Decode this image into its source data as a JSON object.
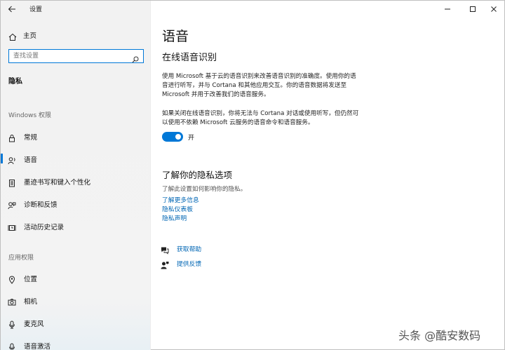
{
  "window": {
    "title": "设置",
    "controls": [
      "minimize-icon",
      "maximize-icon",
      "close-icon"
    ]
  },
  "sidebar": {
    "home_label": "主页",
    "search_placeholder": "查找设置",
    "category": "隐私",
    "windows_permissions_header": "Windows 权限",
    "app_permissions_header": "应用权限",
    "windows_items": [
      {
        "label": "常规",
        "icon": "lock-icon"
      },
      {
        "label": "语音",
        "icon": "speech-icon",
        "active": true
      },
      {
        "label": "墨迹书写和键入个性化",
        "icon": "clipboard-icon"
      },
      {
        "label": "诊断和反馈",
        "icon": "feedback-icon"
      },
      {
        "label": "活动历史记录",
        "icon": "history-icon"
      }
    ],
    "app_items": [
      {
        "label": "位置",
        "icon": "location-icon"
      },
      {
        "label": "相机",
        "icon": "camera-icon"
      },
      {
        "label": "麦克风",
        "icon": "microphone-icon"
      },
      {
        "label": "语音激活",
        "icon": "voice-activation-icon"
      }
    ]
  },
  "main": {
    "title": "语音",
    "section_title": "在线语音识别",
    "para1_lines": [
      "使用 Microsoft 基于云的语音识别来改善语音识别的准确度。使用你的语",
      "音进行听写，并与 Cortana 和其他应用交互。你的语音数据将发送至",
      "Microsoft 并用于改善我们的语音服务。"
    ],
    "para2_lines": [
      "如果关闭在线语音识别，你将无法与 Cortana 对话或使用听写，但仍然可",
      "以使用不依赖  Microsoft 云服务的语音命令和语音服务。"
    ],
    "toggle_label": "开",
    "toggle_on": true,
    "accent_color": "#0078d7",
    "privacy_title": "了解你的隐私选项",
    "privacy_desc": "了解此设置如何影响你的隐私。",
    "links": [
      "了解更多信息",
      "隐私仪表板",
      "隐私声明"
    ],
    "help_label": "获取帮助",
    "feedback_label": "提供反馈"
  },
  "watermark": "头条 @酷安数码"
}
